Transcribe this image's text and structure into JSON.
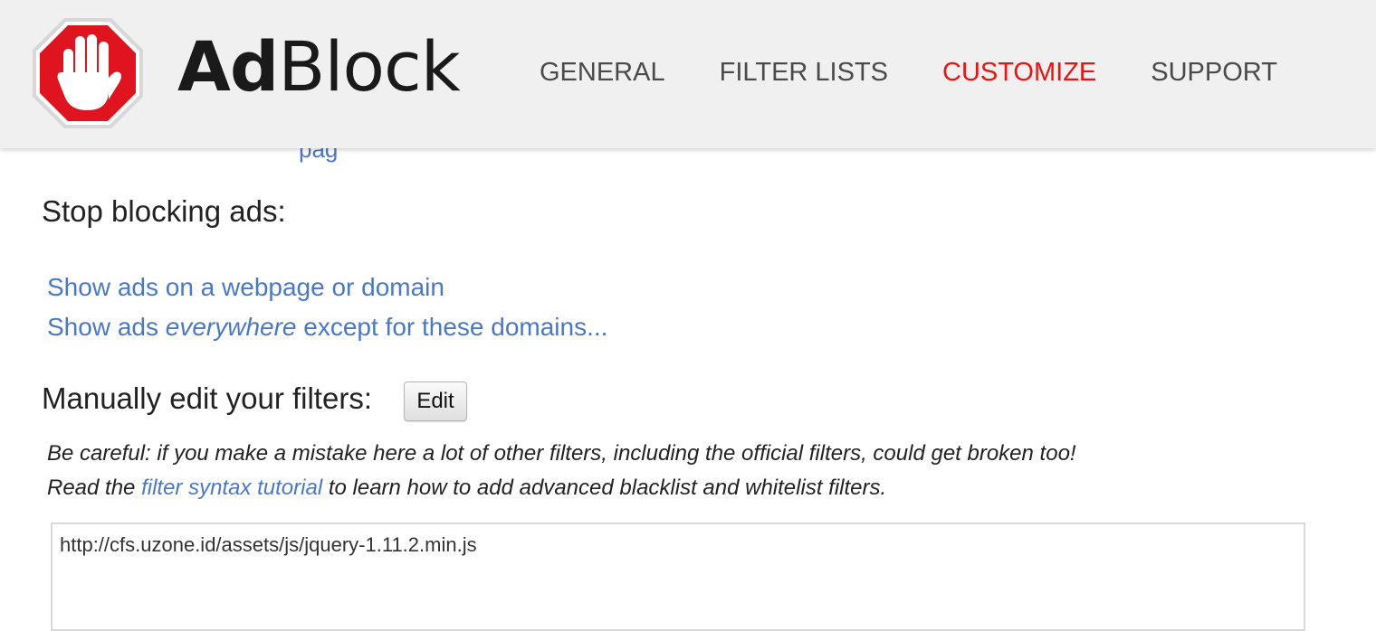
{
  "header": {
    "brand_ad": "Ad",
    "brand_block": "Block",
    "nav": [
      {
        "label": "GENERAL",
        "active": false
      },
      {
        "label": "FILTER LISTS",
        "active": false
      },
      {
        "label": "CUSTOMIZE",
        "active": true
      },
      {
        "label": "SUPPORT",
        "active": false
      }
    ],
    "accent_color": "#ee1111"
  },
  "partial_link": "pag",
  "stop_section": {
    "title": "Stop blocking ads:",
    "link_webpage": "Show ads on a webpage or domain",
    "link_everywhere_pre": "Show ads ",
    "link_everywhere_em": "everywhere",
    "link_everywhere_post": " except for these domains..."
  },
  "edit_section": {
    "title": "Manually edit your filters:",
    "edit_button": "Edit",
    "warning": "Be careful: if you make a mistake here a lot of other filters, including the official filters, could get broken too!",
    "read_pre": "Read the ",
    "tutorial_link": "filter syntax tutorial",
    "read_post": " to learn how to add advanced blacklist and whitelist filters.",
    "filter_text": "http://cfs.uzone.id/assets/js/jquery-1.11.2.min.js"
  }
}
